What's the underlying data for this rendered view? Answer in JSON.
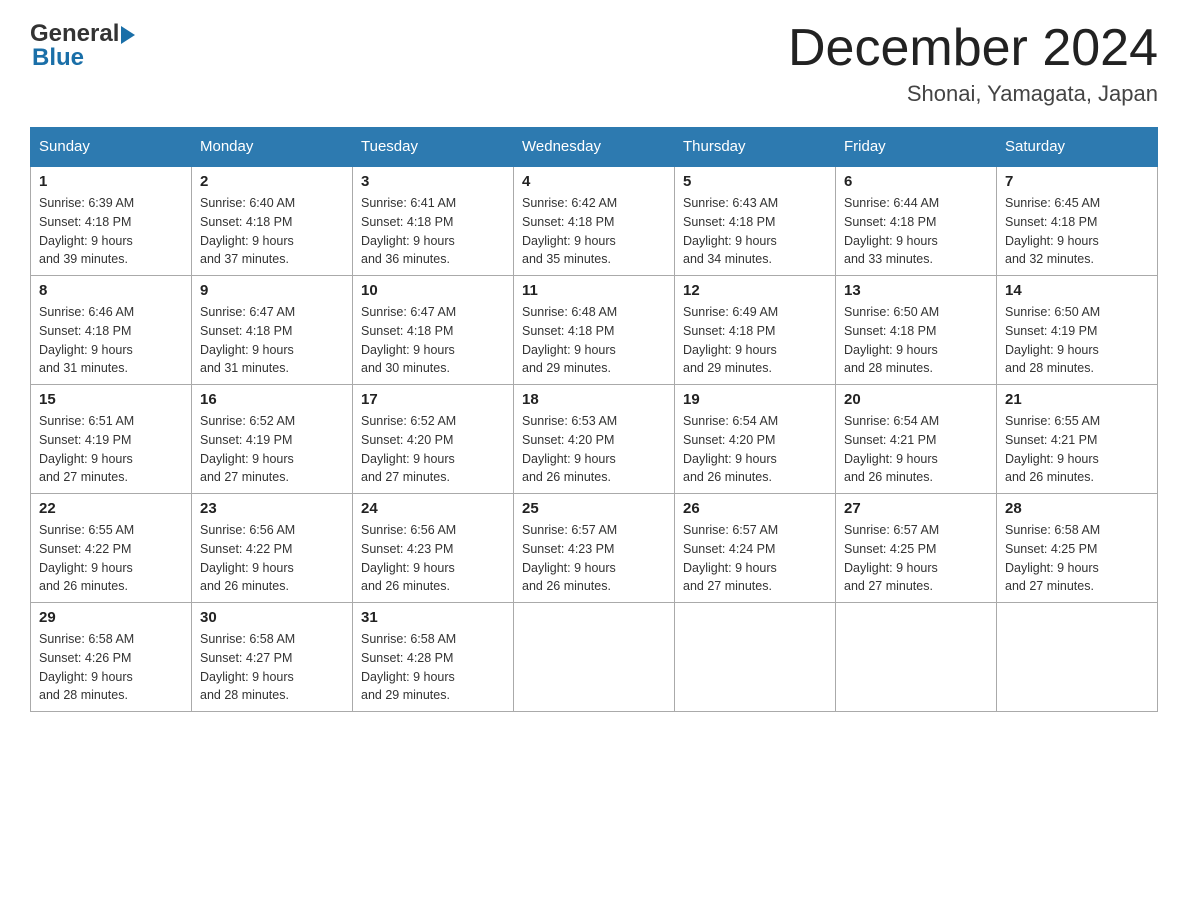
{
  "header": {
    "logo_general": "General",
    "logo_blue": "Blue",
    "month_title": "December 2024",
    "location": "Shonai, Yamagata, Japan"
  },
  "days_of_week": [
    "Sunday",
    "Monday",
    "Tuesday",
    "Wednesday",
    "Thursday",
    "Friday",
    "Saturday"
  ],
  "weeks": [
    [
      {
        "day": "1",
        "sunrise": "6:39 AM",
        "sunset": "4:18 PM",
        "daylight": "9 hours and 39 minutes."
      },
      {
        "day": "2",
        "sunrise": "6:40 AM",
        "sunset": "4:18 PM",
        "daylight": "9 hours and 37 minutes."
      },
      {
        "day": "3",
        "sunrise": "6:41 AM",
        "sunset": "4:18 PM",
        "daylight": "9 hours and 36 minutes."
      },
      {
        "day": "4",
        "sunrise": "6:42 AM",
        "sunset": "4:18 PM",
        "daylight": "9 hours and 35 minutes."
      },
      {
        "day": "5",
        "sunrise": "6:43 AM",
        "sunset": "4:18 PM",
        "daylight": "9 hours and 34 minutes."
      },
      {
        "day": "6",
        "sunrise": "6:44 AM",
        "sunset": "4:18 PM",
        "daylight": "9 hours and 33 minutes."
      },
      {
        "day": "7",
        "sunrise": "6:45 AM",
        "sunset": "4:18 PM",
        "daylight": "9 hours and 32 minutes."
      }
    ],
    [
      {
        "day": "8",
        "sunrise": "6:46 AM",
        "sunset": "4:18 PM",
        "daylight": "9 hours and 31 minutes."
      },
      {
        "day": "9",
        "sunrise": "6:47 AM",
        "sunset": "4:18 PM",
        "daylight": "9 hours and 31 minutes."
      },
      {
        "day": "10",
        "sunrise": "6:47 AM",
        "sunset": "4:18 PM",
        "daylight": "9 hours and 30 minutes."
      },
      {
        "day": "11",
        "sunrise": "6:48 AM",
        "sunset": "4:18 PM",
        "daylight": "9 hours and 29 minutes."
      },
      {
        "day": "12",
        "sunrise": "6:49 AM",
        "sunset": "4:18 PM",
        "daylight": "9 hours and 29 minutes."
      },
      {
        "day": "13",
        "sunrise": "6:50 AM",
        "sunset": "4:18 PM",
        "daylight": "9 hours and 28 minutes."
      },
      {
        "day": "14",
        "sunrise": "6:50 AM",
        "sunset": "4:19 PM",
        "daylight": "9 hours and 28 minutes."
      }
    ],
    [
      {
        "day": "15",
        "sunrise": "6:51 AM",
        "sunset": "4:19 PM",
        "daylight": "9 hours and 27 minutes."
      },
      {
        "day": "16",
        "sunrise": "6:52 AM",
        "sunset": "4:19 PM",
        "daylight": "9 hours and 27 minutes."
      },
      {
        "day": "17",
        "sunrise": "6:52 AM",
        "sunset": "4:20 PM",
        "daylight": "9 hours and 27 minutes."
      },
      {
        "day": "18",
        "sunrise": "6:53 AM",
        "sunset": "4:20 PM",
        "daylight": "9 hours and 26 minutes."
      },
      {
        "day": "19",
        "sunrise": "6:54 AM",
        "sunset": "4:20 PM",
        "daylight": "9 hours and 26 minutes."
      },
      {
        "day": "20",
        "sunrise": "6:54 AM",
        "sunset": "4:21 PM",
        "daylight": "9 hours and 26 minutes."
      },
      {
        "day": "21",
        "sunrise": "6:55 AM",
        "sunset": "4:21 PM",
        "daylight": "9 hours and 26 minutes."
      }
    ],
    [
      {
        "day": "22",
        "sunrise": "6:55 AM",
        "sunset": "4:22 PM",
        "daylight": "9 hours and 26 minutes."
      },
      {
        "day": "23",
        "sunrise": "6:56 AM",
        "sunset": "4:22 PM",
        "daylight": "9 hours and 26 minutes."
      },
      {
        "day": "24",
        "sunrise": "6:56 AM",
        "sunset": "4:23 PM",
        "daylight": "9 hours and 26 minutes."
      },
      {
        "day": "25",
        "sunrise": "6:57 AM",
        "sunset": "4:23 PM",
        "daylight": "9 hours and 26 minutes."
      },
      {
        "day": "26",
        "sunrise": "6:57 AM",
        "sunset": "4:24 PM",
        "daylight": "9 hours and 27 minutes."
      },
      {
        "day": "27",
        "sunrise": "6:57 AM",
        "sunset": "4:25 PM",
        "daylight": "9 hours and 27 minutes."
      },
      {
        "day": "28",
        "sunrise": "6:58 AM",
        "sunset": "4:25 PM",
        "daylight": "9 hours and 27 minutes."
      }
    ],
    [
      {
        "day": "29",
        "sunrise": "6:58 AM",
        "sunset": "4:26 PM",
        "daylight": "9 hours and 28 minutes."
      },
      {
        "day": "30",
        "sunrise": "6:58 AM",
        "sunset": "4:27 PM",
        "daylight": "9 hours and 28 minutes."
      },
      {
        "day": "31",
        "sunrise": "6:58 AM",
        "sunset": "4:28 PM",
        "daylight": "9 hours and 29 minutes."
      },
      null,
      null,
      null,
      null
    ]
  ],
  "labels": {
    "sunrise": "Sunrise:",
    "sunset": "Sunset:",
    "daylight": "Daylight:"
  }
}
